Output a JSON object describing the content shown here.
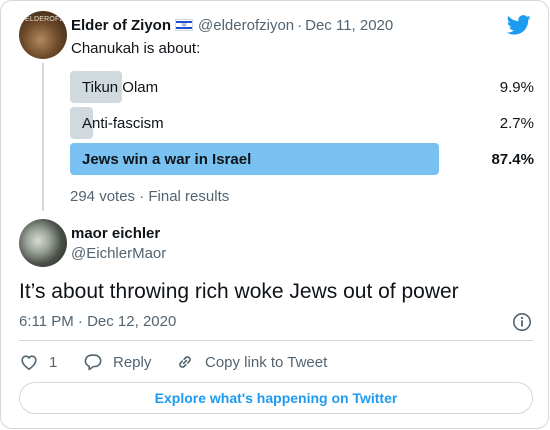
{
  "quoted_tweet": {
    "avatar_text": "ELDEROFZ",
    "display_name": "Elder of Ziyon",
    "flag_icon": "israel-flag-icon",
    "handle": "@elderofziyon",
    "separator": "·",
    "date": "Dec 11, 2020",
    "text": "Chanukah is about:",
    "poll": {
      "options": [
        {
          "label": "Tikun Olam",
          "percent_text": "9.9%",
          "percent": 9.9,
          "winner": false
        },
        {
          "label": "Anti-fascism",
          "percent_text": "2.7%",
          "percent": 2.7,
          "winner": false
        },
        {
          "label": "Jews win a war in Israel",
          "percent_text": "87.4%",
          "percent": 87.4,
          "winner": true
        }
      ],
      "meta": "294 votes · Final results"
    }
  },
  "reply_tweet": {
    "display_name": "maor eichler",
    "handle": "@EichlerMaor",
    "text": "It’s about throwing rich woke Jews out of power",
    "timestamp": "6:11 PM · Dec 12, 2020"
  },
  "actions": {
    "like_count": "1",
    "reply_label": "Reply",
    "copy_link_label": "Copy link to Tweet"
  },
  "explore_label": "Explore what's happening on Twitter",
  "colors": {
    "accent": "#1d9bf0",
    "poll_winner": "#79c1f1",
    "poll_other": "#cfd9de",
    "secondary_text": "#536471"
  }
}
